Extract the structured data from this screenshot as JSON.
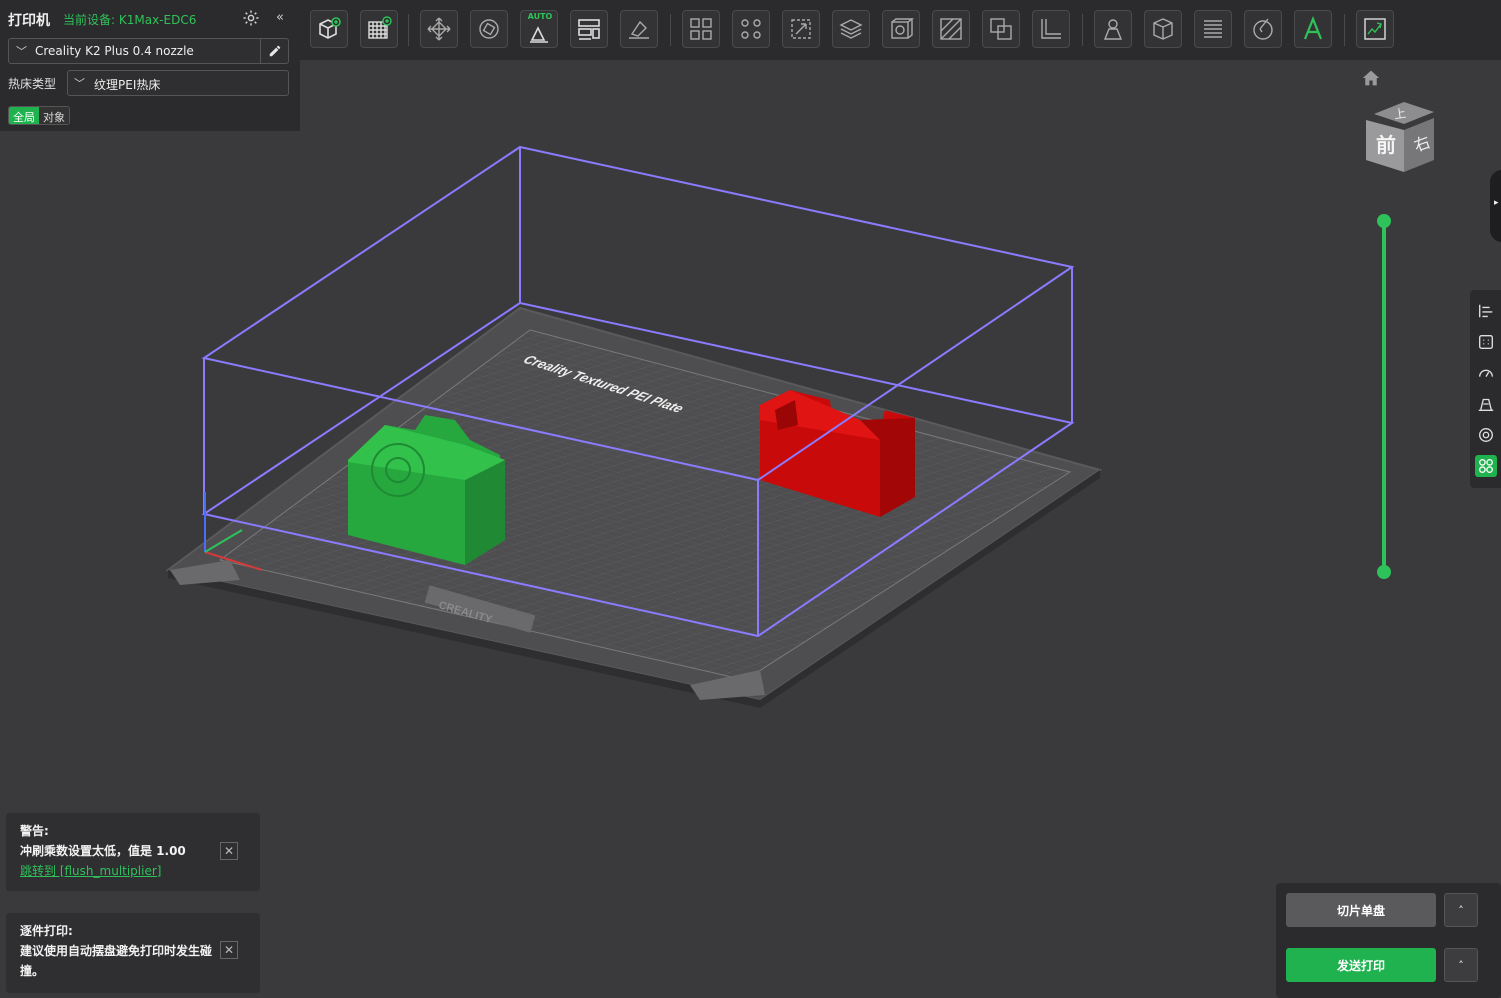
{
  "printer_panel": {
    "title": "打印机",
    "current_device": "当前设备: K1Max-EDC6",
    "printer_name": "Creality K2 Plus 0.4 nozzle",
    "bed_type_label": "热床类型",
    "bed_type_value": "纹理PEI热床",
    "scope_tabs": [
      "全局",
      "对象"
    ],
    "active_scope": "全局",
    "collapse_glyph": "«",
    "chevron_glyph": "﹀"
  },
  "toolbar": {
    "auto_tag": "AUTO",
    "tools": [
      "add-object",
      "add-plate",
      "auto-orient",
      "auto-arrange-auto",
      "arrange",
      "lay-on-face",
      "split-objects",
      "split-parts",
      "scale",
      "cut",
      "hollow",
      "support-paint",
      "seam-paint",
      "boolean",
      "measure",
      "emboss",
      "assembly",
      "layer-list",
      "color-paint",
      "text",
      "preview-toggle"
    ]
  },
  "scene": {
    "plate_label": "Creality Textured PEI Plate",
    "brand_label": "CREALITY",
    "green_object": "green-camera-model",
    "red_object": "red-holder-model",
    "colors": {
      "background": "#3a3a3c",
      "build_volume": "#8a7bff",
      "plate": "#4a4a4c",
      "green_object": "#27a83f",
      "red_object": "#d40e0e",
      "accent": "#2ec25a"
    }
  },
  "nav_cube": {
    "top": "上",
    "front": "前",
    "right": "右"
  },
  "edge_tab_glyph": "▸",
  "layer_slider": {
    "top_value": 1.0,
    "bottom_value": 0.0
  },
  "notifications": [
    {
      "title": "警告:",
      "body": "冲刷乘数设置太低，值是 1.00",
      "link": "跳转到 [flush_multiplier]",
      "close": "✕"
    },
    {
      "title": "逐件打印:",
      "body": "建议使用自动摆盘避免打印时发生碰撞。",
      "close": "✕"
    }
  ],
  "actions": {
    "slice_label": "切片单盘",
    "send_label": "发送打印",
    "more_glyph": "˄"
  }
}
